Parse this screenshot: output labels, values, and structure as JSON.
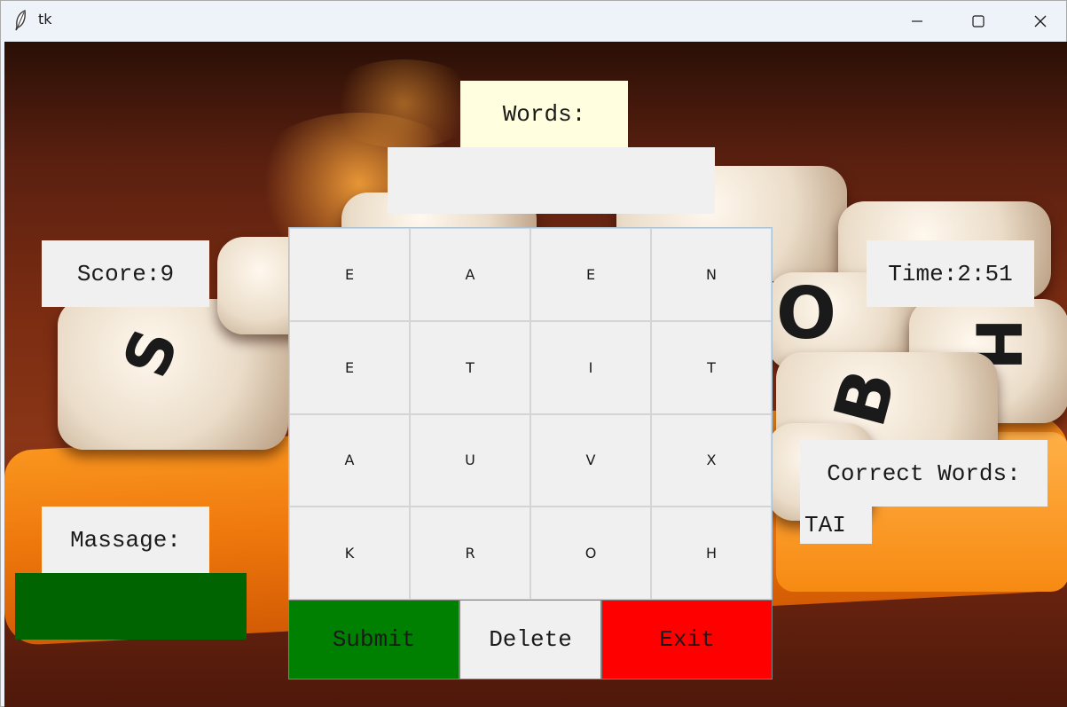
{
  "window": {
    "title": "tk",
    "icon": "feather-icon",
    "controls": [
      "minimize-icon",
      "maximize-icon",
      "close-icon"
    ]
  },
  "game": {
    "words_label": "Words:",
    "words_entry": "",
    "score_label": "Score:9",
    "time_label": "Time:2:51",
    "correct_words_label": "Correct Words:",
    "correct_words": [
      "TAI"
    ],
    "massage_label": "Massage:",
    "massage_text": "",
    "grid": [
      [
        "E",
        "A",
        "E",
        "N"
      ],
      [
        "E",
        "T",
        "I",
        "T"
      ],
      [
        "A",
        "U",
        "V",
        "X"
      ],
      [
        "K",
        "R",
        "O",
        "H"
      ]
    ],
    "buttons": {
      "submit": "Submit",
      "delete": "Delete",
      "exit": "Exit"
    }
  },
  "colors": {
    "words_label_bg": "#ffffe0",
    "massage_box_bg": "#006400",
    "submit_bg": "#008000",
    "exit_bg": "#ff0000",
    "panel_bg": "#f0f0f0"
  },
  "background_image": "boggle-dice-photo"
}
